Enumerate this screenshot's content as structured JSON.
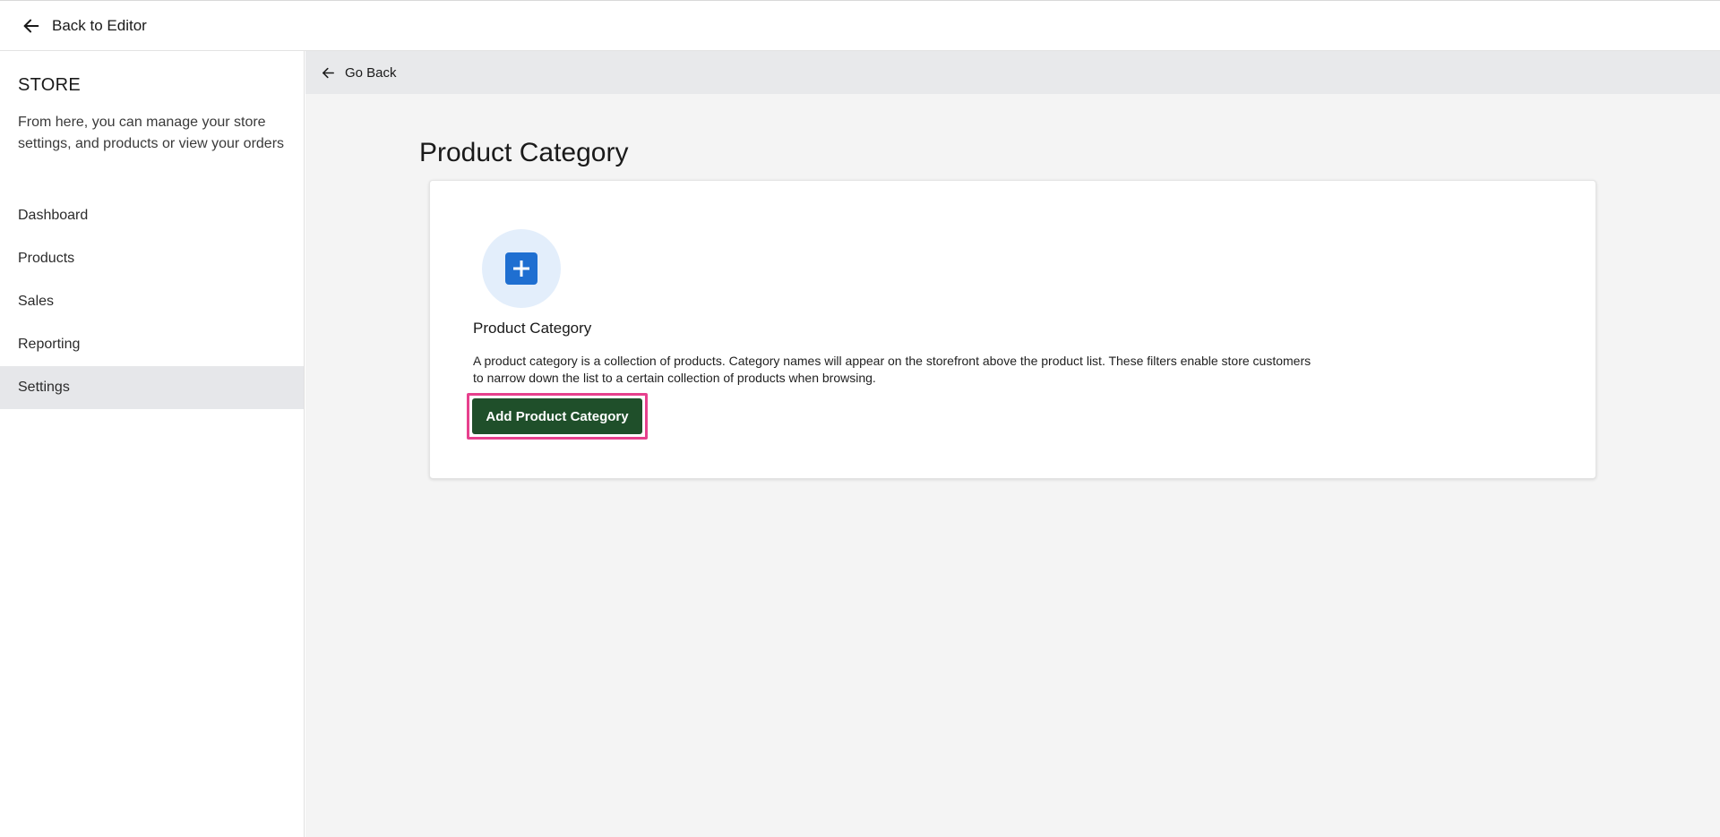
{
  "topbar": {
    "back_label": "Back to Editor",
    "back_icon": "arrow-left-icon"
  },
  "sidebar": {
    "title": "STORE",
    "description": "From here, you can manage your store settings, and products or view your orders",
    "items": [
      {
        "label": "Dashboard",
        "active": false
      },
      {
        "label": "Products",
        "active": false
      },
      {
        "label": "Sales",
        "active": false
      },
      {
        "label": "Reporting",
        "active": false
      },
      {
        "label": "Settings",
        "active": true
      }
    ]
  },
  "main": {
    "go_back_label": "Go Back",
    "go_back_icon": "arrow-left-icon",
    "page_title": "Product Category",
    "card": {
      "icon": "plus-square-icon",
      "title": "Product Category",
      "description": "A product category is a collection of products. Category names will appear on the storefront above the product list. These filters enable store customers to narrow down the list to a certain collection of products when browsing.",
      "button_label": "Add Product Category"
    }
  },
  "colors": {
    "button_bg": "#1f4f2a",
    "highlight": "#e7408d",
    "icon_blue": "#1f6fd1",
    "icon_circle": "#e3eefb",
    "active_nav": "#e6e7ea"
  }
}
